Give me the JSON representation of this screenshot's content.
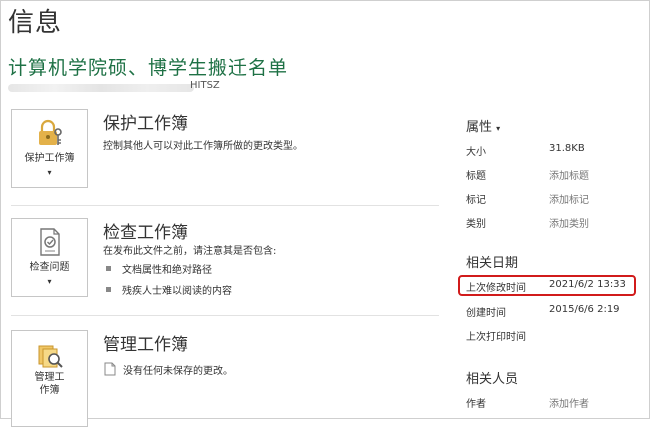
{
  "page": {
    "title": "信息"
  },
  "document": {
    "title": "计算机学院硕、博学生搬迁名单",
    "path_suffix": "HITSZ"
  },
  "sections": {
    "protect": {
      "card_label": "保护工作簿",
      "title": "保护工作簿",
      "description": "控制其他人可以对此工作簿所做的更改类型。",
      "icon": "lock-key-icon"
    },
    "inspect": {
      "card_label": "检查问题",
      "title": "检查工作簿",
      "description": "在发布此文件之前，请注意其是否包含:",
      "bullets": [
        "文档属性和绝对路径",
        "残疾人士难以阅读的内容"
      ],
      "icon": "inspect-document-icon"
    },
    "manage": {
      "card_label_line1": "管理工",
      "card_label_line2": "作簿",
      "title": "管理工作簿",
      "description": "没有任何未保存的更改。",
      "icon": "manage-workbook-icon"
    }
  },
  "properties": {
    "heading": "属性",
    "items": [
      {
        "label": "大小",
        "value": "31.8KB"
      },
      {
        "label": "标题",
        "value": "添加标题"
      },
      {
        "label": "标记",
        "value": "添加标记"
      },
      {
        "label": "类别",
        "value": "添加类别"
      }
    ]
  },
  "related_dates": {
    "heading": "相关日期",
    "last_modified": {
      "label": "上次修改时间",
      "value": "2021/6/2 13:33"
    },
    "created": {
      "label": "创建时间",
      "value": "2015/6/6 2:19"
    },
    "last_printed": {
      "label": "上次打印时间",
      "value": ""
    }
  },
  "related_people": {
    "heading": "相关人员",
    "author": {
      "label": "作者",
      "value": "添加作者"
    }
  },
  "colors": {
    "doc_title": "#1e7145",
    "highlight": "#d11b1b",
    "lock": "#e3b14a"
  }
}
